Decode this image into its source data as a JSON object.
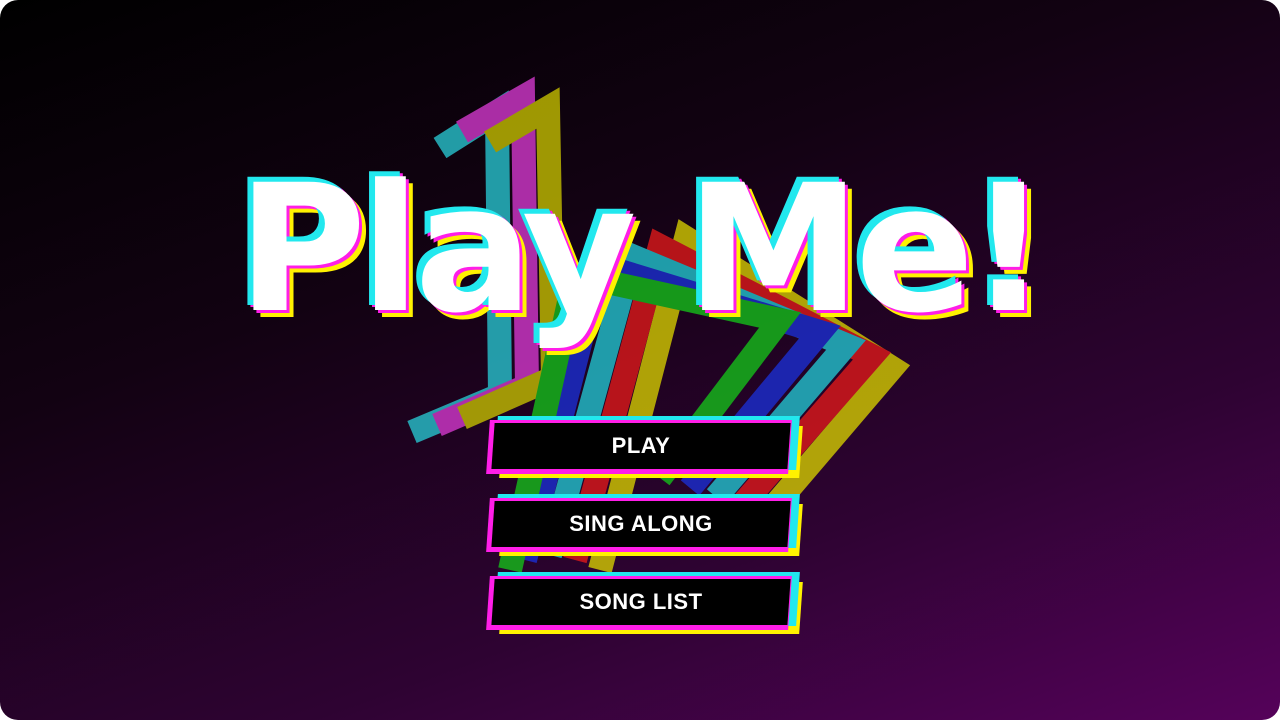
{
  "game": {
    "title": "Play Me!"
  },
  "menu": {
    "play_label": "PLAY",
    "sing_along_label": "SING ALONG",
    "song_list_label": "SONG LIST"
  },
  "colors": {
    "cyan": "#22e8ee",
    "magenta": "#ff1ee8",
    "yellow": "#fff200",
    "button_fill": "#000000",
    "background_dark": "#000000",
    "background_purple": "#55025a"
  },
  "icons": {
    "logo_art": "play-triangle-rainbow-glitch"
  }
}
